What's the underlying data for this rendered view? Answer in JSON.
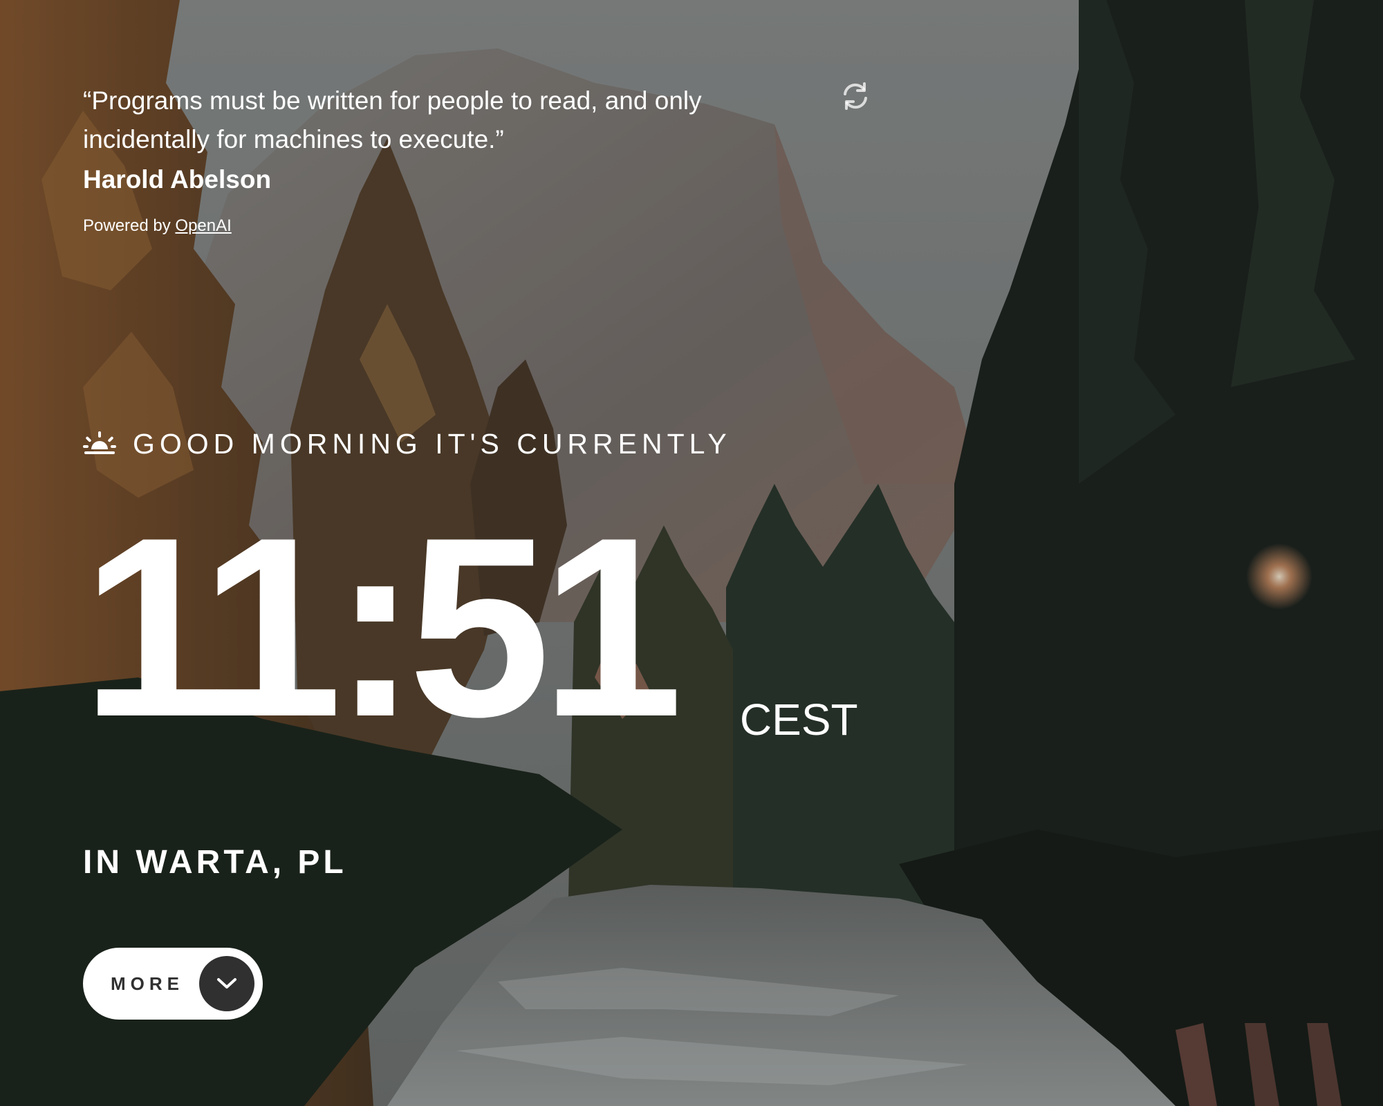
{
  "quote": {
    "text": "“Programs must be written for people to read, and only incidentally for machines to execute.”",
    "author": "Harold Abelson",
    "powered_prefix": "Powered by ",
    "powered_link": "OpenAI"
  },
  "refresh_icon": "refresh-icon",
  "greeting": {
    "icon": "sunrise-icon",
    "text": "GOOD MORNING IT'S CURRENTLY"
  },
  "clock": {
    "time": "11:51",
    "timezone": "CEST"
  },
  "location": "IN WARTA, PL",
  "more_button": {
    "label": "MORE",
    "icon": "chevron-down-icon"
  },
  "colors": {
    "text": "#ffffff",
    "button_bg": "#ffffff",
    "button_text": "#303030",
    "button_circle": "#303030"
  }
}
